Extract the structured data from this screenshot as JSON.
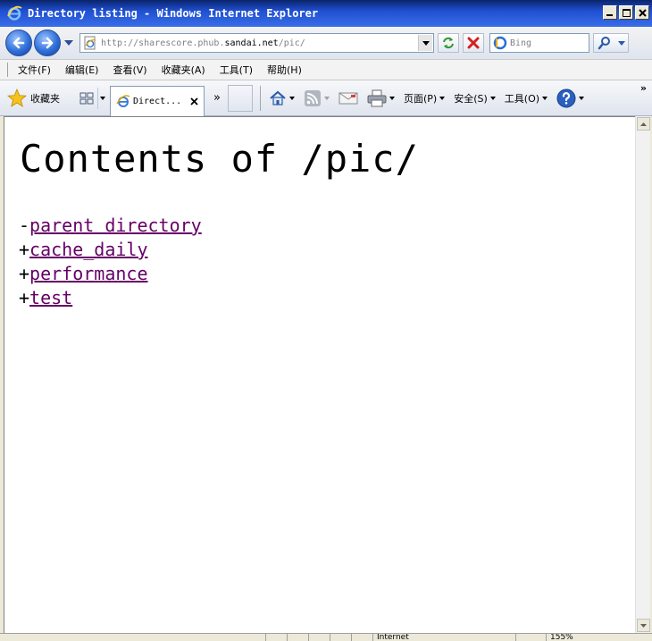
{
  "window": {
    "title": "Directory listing - Windows Internet Explorer"
  },
  "address_bar": {
    "url_prefix": "http://sharescore.phub.",
    "url_host": "sandai.net",
    "url_suffix": "/pic/"
  },
  "search": {
    "placeholder": "Bing"
  },
  "menu": {
    "items": [
      "文件(F)",
      "编辑(E)",
      "查看(V)",
      "收藏夹(A)",
      "工具(T)",
      "帮助(H)"
    ]
  },
  "toolbar": {
    "favorites_label": "收藏夹",
    "tab_label": "Direct...",
    "more_tabs": "»",
    "page_label": "页面(P)",
    "safety_label": "安全(S)",
    "tools_label": "工具(O)",
    "overflow": "»"
  },
  "page": {
    "heading": "Contents of /pic/",
    "entries": [
      {
        "prefix": "-",
        "name": "parent directory"
      },
      {
        "prefix": "+",
        "name": "cache_daily"
      },
      {
        "prefix": "+",
        "name": "performance"
      },
      {
        "prefix": "+",
        "name": "test"
      }
    ]
  },
  "status": {
    "zone_label": "Internet",
    "zoom_label": "155%"
  },
  "colors": {
    "visited_link": "#660066",
    "title_bar": "#1f4fd1"
  },
  "icons": [
    "ie-logo-icon",
    "back-arrow-icon",
    "forward-arrow-icon",
    "refresh-icon",
    "stop-icon",
    "bing-icon",
    "search-icon",
    "star-icon",
    "quick-tabs-icon",
    "home-icon",
    "rss-icon",
    "mail-icon",
    "printer-icon",
    "help-icon"
  ]
}
